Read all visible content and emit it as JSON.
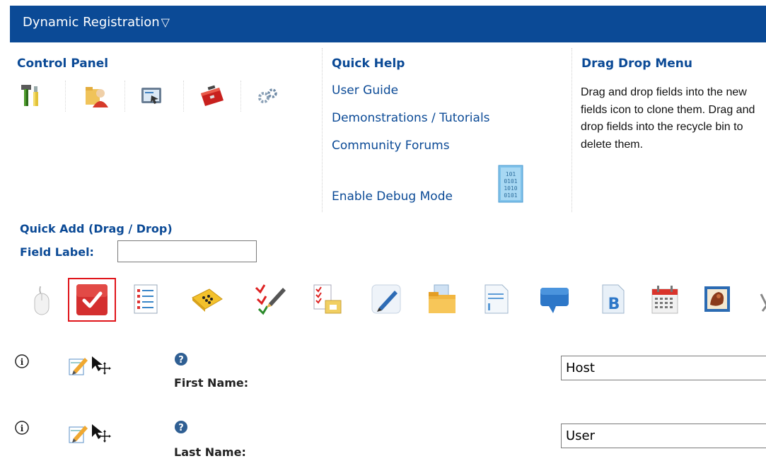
{
  "header": {
    "title": "Dynamic Registration",
    "menu_arrow": "▽"
  },
  "control_panel": {
    "title": "Control Panel",
    "icons": [
      "tools-icon",
      "user-folder-icon",
      "display-icon",
      "toolbox-icon",
      "gears-icon"
    ]
  },
  "quick_help": {
    "title": "Quick Help",
    "links": [
      "User Guide",
      "Demonstrations / Tutorials",
      "Community Forums"
    ],
    "debug_label": "Enable Debug Mode"
  },
  "drag_drop": {
    "title": "Drag Drop Menu",
    "description": "Drag and drop fields into the new fields icon to clone them. Drag and drop fields into the recycle bin to delete them."
  },
  "quick_add": {
    "title": "Quick Add (Drag / Drop)",
    "field_label": "Field Label:",
    "field_value": ""
  },
  "tools": [
    "mouse-icon",
    "checkbox-icon",
    "list-icon",
    "dice-icon",
    "checklist-edit-icon",
    "checklist-folder-icon",
    "pencil-icon",
    "folder-icon",
    "document-icon",
    "comment-icon",
    "bold-doc-icon",
    "calendar-icon",
    "image-icon"
  ],
  "fields": [
    {
      "label": "First Name:",
      "value": "Host"
    },
    {
      "label": "Last Name:",
      "value": "User"
    }
  ],
  "colors": {
    "brand": "#0b4a96",
    "highlight": "#e0141a",
    "checkbox": "#d42f2f"
  }
}
